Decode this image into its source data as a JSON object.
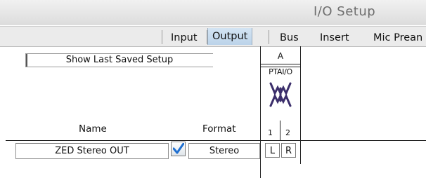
{
  "window": {
    "title": "I/O Setup"
  },
  "tabs": [
    {
      "label": "Input",
      "selected": false
    },
    {
      "label": "Output",
      "selected": true
    },
    {
      "label": "Bus",
      "selected": false
    },
    {
      "label": "Insert",
      "selected": false
    },
    {
      "label": "Mic Prean",
      "selected": false
    }
  ],
  "toolbar": {
    "show_last_saved": "Show Last Saved Setup"
  },
  "columns": {
    "name": "Name",
    "format": "Format"
  },
  "device": {
    "block_label": "A",
    "name": "PTAI/O",
    "icon": "digidesign-logo-icon",
    "channels": [
      "1",
      "2"
    ]
  },
  "rows": [
    {
      "name": "ZED Stereo OUT",
      "active": true,
      "format": "Stereo",
      "assign": [
        "L",
        "R"
      ]
    }
  ],
  "colors": {
    "selected_tab": "#c6daee",
    "checkmark": "#1f6fd0",
    "logo": "#3b2e6b"
  }
}
